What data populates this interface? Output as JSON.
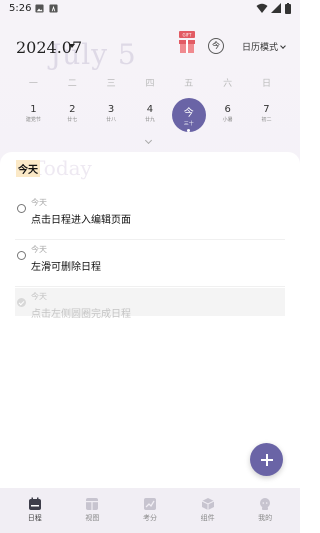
{
  "status_bar": {
    "time": "5:26"
  },
  "header": {
    "date": "2024.07",
    "ghost_text": "July 5",
    "gift_badge": "GIFT",
    "today_button": "今",
    "mode_label": "日历模式"
  },
  "weekdays": [
    "一",
    "二",
    "三",
    "四",
    "五",
    "六",
    "日"
  ],
  "days": [
    {
      "num": "1",
      "lunar": "建党节"
    },
    {
      "num": "2",
      "lunar": "廿七"
    },
    {
      "num": "3",
      "lunar": "廿八"
    },
    {
      "num": "4",
      "lunar": "廿九"
    },
    {
      "num": "今",
      "lunar": "三十",
      "selected": true
    },
    {
      "num": "6",
      "lunar": "小暑"
    },
    {
      "num": "7",
      "lunar": "初二"
    }
  ],
  "main": {
    "ghost_text": "Today",
    "section_label": "今天",
    "tasks": [
      {
        "day": "今天",
        "title": "点击日程进入编辑页面",
        "done": false
      },
      {
        "day": "今天",
        "title": "左滑可删除日程",
        "done": false
      },
      {
        "day": "今天",
        "title": "点击左侧圆圈完成日程",
        "done": true
      }
    ]
  },
  "nav": [
    {
      "label": "日程",
      "icon": "schedule-icon",
      "active": true
    },
    {
      "label": "视图",
      "icon": "view-icon",
      "active": false
    },
    {
      "label": "考分",
      "icon": "chart-icon",
      "active": false
    },
    {
      "label": "组件",
      "icon": "widget-icon",
      "active": false
    },
    {
      "label": "我的",
      "icon": "profile-icon",
      "active": false
    }
  ],
  "colors": {
    "accent": "#6a64a6",
    "highlight": "#fbe9c7"
  }
}
